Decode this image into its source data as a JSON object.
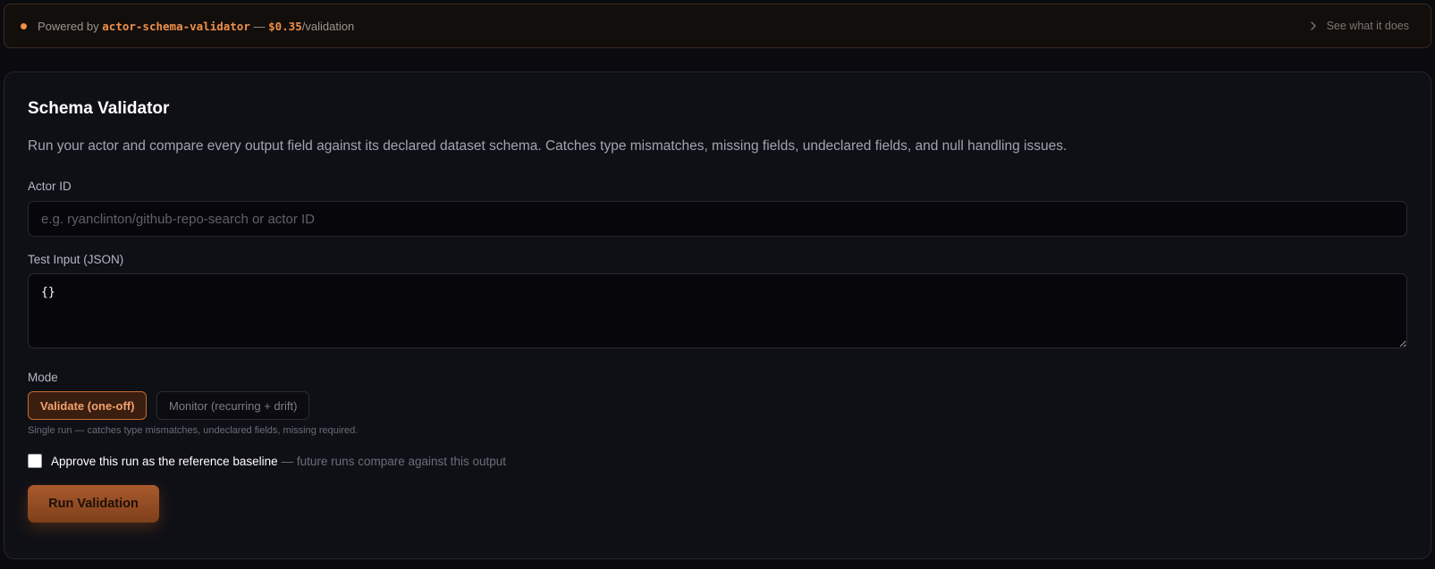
{
  "banner": {
    "powered_prefix": "Powered by",
    "actor_name": "actor-schema-validator",
    "separator": "—",
    "price": "$0.35",
    "price_suffix": "/validation",
    "link_label": "See what it does"
  },
  "form": {
    "title": "Schema Validator",
    "description": "Run your actor and compare every output field against its declared dataset schema. Catches type mismatches, missing fields, undeclared fields, and null handling issues.",
    "actor_id_label": "Actor ID",
    "actor_id_placeholder": "e.g. ryanclinton/github-repo-search or actor ID",
    "actor_id_value": "",
    "test_input_label": "Test Input (JSON)",
    "test_input_value": "{}",
    "mode_label": "Mode",
    "modes": [
      {
        "label": "Validate (one-off)",
        "selected": true
      },
      {
        "label": "Monitor (recurring + drift)",
        "selected": false
      }
    ],
    "mode_hint": "Single run — catches type mismatches, undeclared fields, missing required.",
    "baseline_label": "Approve this run as the reference baseline",
    "baseline_hint": "— future runs compare against this output",
    "baseline_checked": false,
    "submit_label": "Run Validation"
  },
  "colors": {
    "accent": "#f0904a",
    "background": "#0b0b0f",
    "card": "#0f1016"
  }
}
